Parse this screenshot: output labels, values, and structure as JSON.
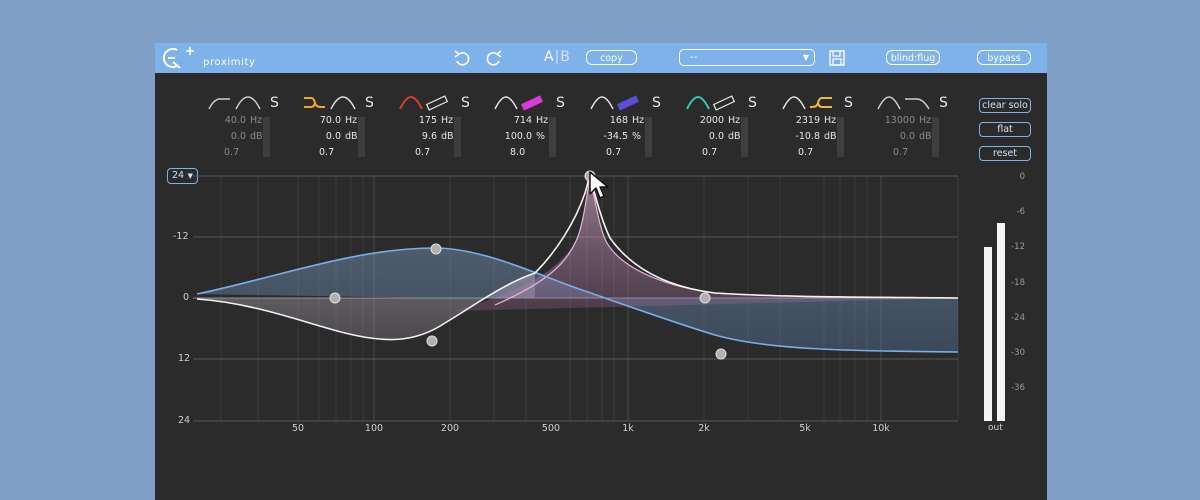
{
  "app": {
    "name": "proximity"
  },
  "toolbar": {
    "ab_a": "A",
    "ab_sep": "|",
    "ab_b": "B",
    "copy_label": "copy",
    "preset_value": "--",
    "blindflug_label": "blind:flug",
    "bypass_label": "bypass"
  },
  "bands": [
    {
      "freq": "40.0",
      "freq_unit": "Hz",
      "gain": "0.0",
      "gain_unit": "dB",
      "q": "0.7",
      "solo": "S",
      "active": false,
      "color": "#e0e0e0"
    },
    {
      "freq": "70.0",
      "freq_unit": "Hz",
      "gain": "0.0",
      "gain_unit": "dB",
      "q": "0.7",
      "solo": "S",
      "active": true,
      "color": "#f0a830"
    },
    {
      "freq": "175",
      "freq_unit": "Hz",
      "gain": "9.6",
      "gain_unit": "dB",
      "q": "0.7",
      "solo": "S",
      "active": true,
      "color": "#e03a2e"
    },
    {
      "freq": "714",
      "freq_unit": "Hz",
      "gain": "100.0",
      "gain_unit": "%",
      "q": "8.0",
      "solo": "S",
      "active": true,
      "color": "#d93ad9"
    },
    {
      "freq": "168",
      "freq_unit": "Hz",
      "gain": "-34.5",
      "gain_unit": "%",
      "q": "0.7",
      "solo": "S",
      "active": true,
      "color": "#5a4fd8"
    },
    {
      "freq": "2000",
      "freq_unit": "Hz",
      "gain": "0.0",
      "gain_unit": "dB",
      "q": "0.7",
      "solo": "S",
      "active": true,
      "color": "#2ec9b0"
    },
    {
      "freq": "2319",
      "freq_unit": "Hz",
      "gain": "-10.8",
      "gain_unit": "dB",
      "q": "0.7",
      "solo": "S",
      "active": true,
      "color": "#f0b840"
    },
    {
      "freq": "13000",
      "freq_unit": "Hz",
      "gain": "0.0",
      "gain_unit": "dB",
      "q": "0.7",
      "solo": "S",
      "active": false,
      "color": "#e0e0e0"
    }
  ],
  "side_buttons": {
    "clear_solo": "clear solo",
    "flat": "flat",
    "reset": "reset"
  },
  "range_selector": {
    "value": "24"
  },
  "graph": {
    "db_labels": [
      "-12",
      "0",
      "12",
      "24"
    ],
    "freq_labels": [
      "50",
      "100",
      "200",
      "500",
      "1k",
      "2k",
      "5k",
      "10k"
    ]
  },
  "meter": {
    "scale": [
      "0",
      "-6",
      "-12",
      "-18",
      "-24",
      "-30",
      "-36"
    ],
    "label": "out",
    "levels_db": [
      -12,
      -8
    ]
  },
  "colors": {
    "titlebar": "#7fb2ea",
    "background": "#2b2b2b",
    "curve_blue": "#79aee8",
    "curve_white": "#f2f2f2",
    "curve_pink": "#e6b7d8"
  }
}
